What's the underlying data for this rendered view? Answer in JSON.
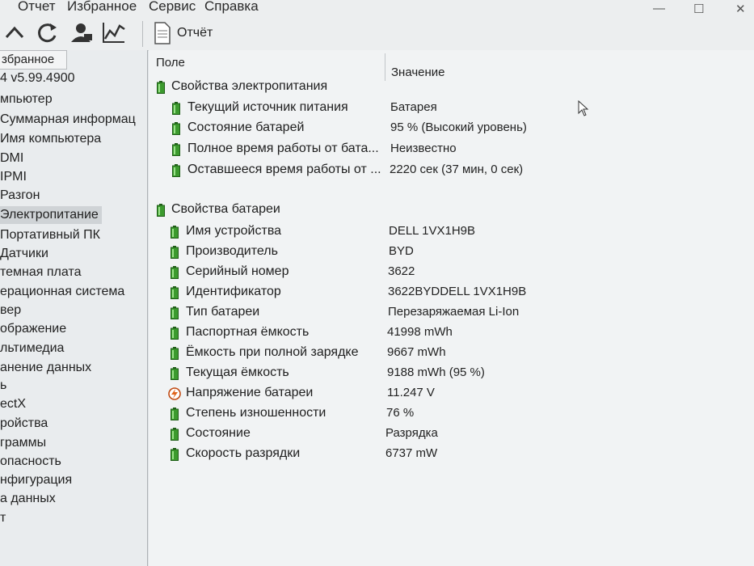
{
  "menu": [
    "Отчет",
    "Избранное",
    "Сервис",
    "Справка"
  ],
  "toolbar": {
    "report_label": "Отчёт"
  },
  "sidebar": {
    "tab": "збранное",
    "items": [
      "4 v5.99.4900",
      "мпьютер",
      "Суммарная информац",
      "Имя компьютера",
      "DMI",
      "IPMI",
      "Разгон",
      "Электропитание",
      "Портативный ПК",
      "Датчики",
      "темная плата",
      "ерационная система",
      "вер",
      "ображение",
      "льтимедиа",
      "анение данных",
      "ь",
      "ectX",
      "ройства",
      "граммы",
      "опасность",
      "нфигурация",
      "а данных",
      "т"
    ],
    "selected_index": 7
  },
  "columns": {
    "field": "Поле",
    "value": "Значение"
  },
  "groups": [
    {
      "title": "Свойства электропитания",
      "rows": [
        {
          "field": "Текущий источник питания",
          "value": "Батарея"
        },
        {
          "field": "Состояние батарей",
          "value": "95 % (Высокий уровень)"
        },
        {
          "field": "Полное время работы от бата...",
          "value": "Неизвестно"
        },
        {
          "field": "Оставшееся время работы от ...",
          "value": "2220 сек (37 мин, 0 сек)"
        }
      ]
    },
    {
      "title": "Свойства батареи",
      "rows": [
        {
          "field": "Имя устройства",
          "value": "DELL 1VX1H9B",
          "icon": "battery"
        },
        {
          "field": "Производитель",
          "value": "BYD",
          "icon": "battery"
        },
        {
          "field": "Серийный номер",
          "value": "3622",
          "icon": "battery"
        },
        {
          "field": "Идентификатор",
          "value": "3622BYDDELL 1VX1H9B",
          "icon": "battery"
        },
        {
          "field": "Тип батареи",
          "value": "Перезаряжаемая Li-Ion",
          "icon": "battery"
        },
        {
          "field": "Паспортная ёмкость",
          "value": "41998 mWh",
          "icon": "battery"
        },
        {
          "field": "Ёмкость при полной зарядке",
          "value": "9667 mWh",
          "icon": "battery"
        },
        {
          "field": "Текущая ёмкость",
          "value": "9188 mWh  (95 %)",
          "icon": "battery"
        },
        {
          "field": "Напряжение батареи",
          "value": "11.247 V",
          "icon": "voltage"
        },
        {
          "field": "Степень изношенности",
          "value": "76 %",
          "icon": "battery"
        },
        {
          "field": "Состояние",
          "value": "Разрядка",
          "icon": "battery"
        },
        {
          "field": "Скорость разрядки",
          "value": "6737 mW",
          "icon": "battery"
        }
      ]
    }
  ],
  "colors": {
    "battery_green": "#3c9a2e",
    "battery_dark": "#1f5e17",
    "selection": "#cfd3d6"
  }
}
